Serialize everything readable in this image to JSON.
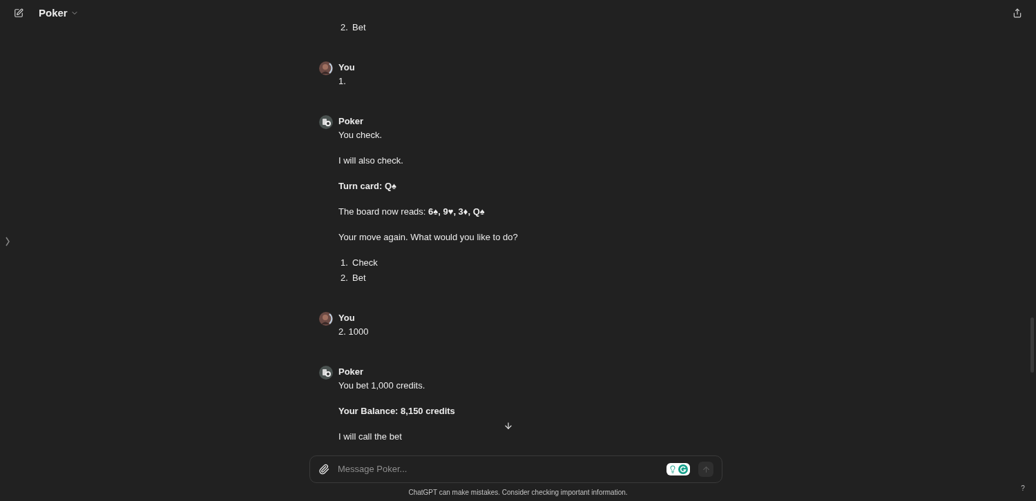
{
  "header": {
    "title": "Poker"
  },
  "messages": [
    {
      "kind": "continuation",
      "blocks": [
        {
          "kind": "list",
          "items": [
            {
              "number": "2.",
              "text": "Bet"
            }
          ]
        }
      ]
    },
    {
      "author": "You",
      "kind": "user",
      "blocks": [
        {
          "kind": "paragraph",
          "text": "1."
        }
      ]
    },
    {
      "author": "Poker",
      "kind": "bot",
      "blocks": [
        {
          "kind": "paragraph",
          "text": "You check."
        },
        {
          "kind": "paragraph",
          "text": "I will also check."
        },
        {
          "kind": "paragraph",
          "text": "**Turn card: Q♠**"
        },
        {
          "kind": "paragraph",
          "text": "The board now reads: **6♠, 9♥, 3♦, Q♠**"
        },
        {
          "kind": "paragraph",
          "text": "Your move again. What would you like to do?"
        },
        {
          "kind": "list",
          "items": [
            {
              "number": "1.",
              "text": "Check"
            },
            {
              "number": "2.",
              "text": "Bet"
            }
          ]
        }
      ]
    },
    {
      "author": "You",
      "kind": "user",
      "blocks": [
        {
          "kind": "paragraph",
          "text": "2. 1000"
        }
      ]
    },
    {
      "author": "Poker",
      "kind": "bot",
      "blocks": [
        {
          "kind": "paragraph",
          "text": "You bet 1,000 credits."
        },
        {
          "kind": "paragraph",
          "text": "**Your Balance: 8,150 credits**"
        },
        {
          "kind": "paragraph",
          "text": "I will call the bet"
        }
      ]
    }
  ],
  "composer": {
    "placeholder": "Message Poker..."
  },
  "footer": "ChatGPT can make mistakes. Consider checking important information.",
  "help": "?"
}
